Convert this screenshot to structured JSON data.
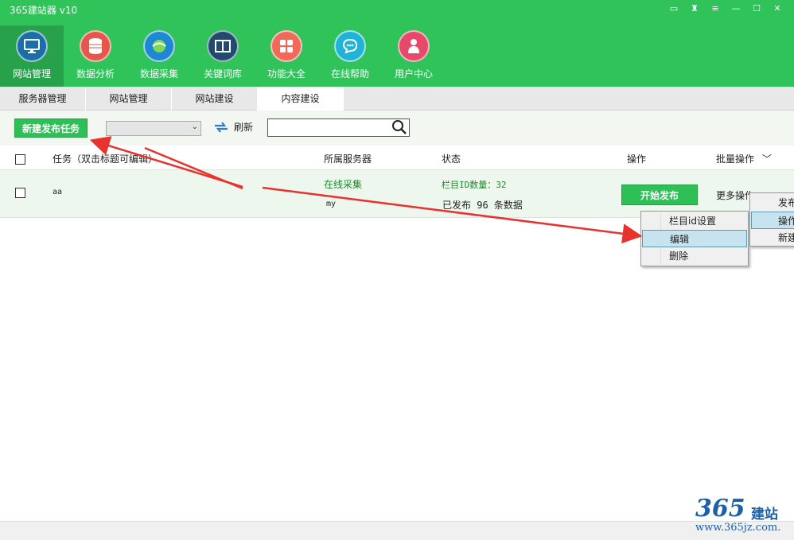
{
  "app": {
    "title": "365建站器 v10"
  },
  "window_controls": [
    "message-icon",
    "shirt-icon",
    "dropdown-icon",
    "minimize-icon",
    "maximize-icon",
    "close-icon"
  ],
  "nav": [
    {
      "label": "网站管理",
      "icon": "monitor-icon",
      "color": "#1a6fa8",
      "active": true
    },
    {
      "label": "数据分析",
      "icon": "database-icon",
      "color": "#e5564b",
      "active": false
    },
    {
      "label": "数据采集",
      "icon": "globe-icon",
      "color": "#1e88d2",
      "active": false
    },
    {
      "label": "关键词库",
      "icon": "book-icon",
      "color": "#224a6e",
      "active": false
    },
    {
      "label": "功能大全",
      "icon": "grid-icon",
      "color": "#f06a5a",
      "active": false
    },
    {
      "label": "在线帮助",
      "icon": "chat-icon",
      "color": "#1fb3d8",
      "active": false
    },
    {
      "label": "用户中心",
      "icon": "user-icon",
      "color": "#e8496a",
      "active": false
    }
  ],
  "subtabs": [
    "服务器管理",
    "网站管理",
    "网站建设",
    "内容建设"
  ],
  "toolbar": {
    "new_task": "新建发布任务",
    "select_value": "",
    "refresh": "刷新",
    "search_value": ""
  },
  "table": {
    "headers": {
      "task": "任务（双击标题可编辑）",
      "server": "所属服务器",
      "status": "状态",
      "op": "操作",
      "batch": "批量操作"
    },
    "rows": [
      {
        "task": "aa",
        "server_link": "在线采集",
        "server_name": "my",
        "status_ids": "栏目ID数量：32",
        "status_published": "已发布 96 条数据",
        "start_button": "开始发布",
        "more_ops": "更多操作"
      }
    ]
  },
  "context_menu": {
    "items": [
      "栏目id设置",
      "编辑",
      "删除"
    ],
    "highlighted": "编辑"
  },
  "batch_menu": {
    "items": [
      "发布",
      "操作",
      "新建"
    ],
    "highlighted": "操作"
  },
  "logo": {
    "text_num": "365",
    "text_cn": "建站",
    "url": "www.365jz.com."
  },
  "colors": {
    "brand_green": "#2fc35a",
    "arrow_red": "#e8322e",
    "link_green": "#1a8a2a"
  }
}
